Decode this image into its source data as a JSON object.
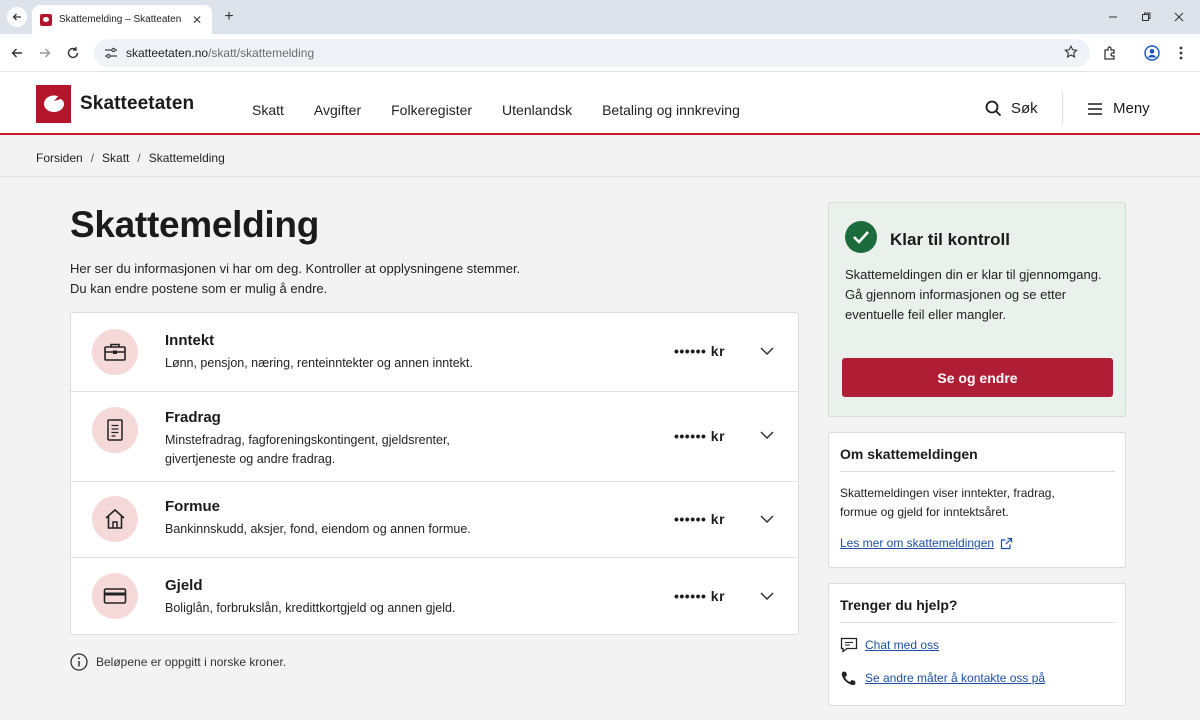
{
  "browser": {
    "tab_title": "Skattemelding – Skatteaten",
    "url_domain": "skatteetaten.no",
    "url_path": "/skatt/skattemelding"
  },
  "site": {
    "brand": "Skatteetaten",
    "nav": [
      "Skatt",
      "Avgifter",
      "Folkeregister",
      "Utenlandsk",
      "Betaling og innkreving"
    ],
    "search_label": "Søk",
    "menu_label": "Meny",
    "accent": "#c8192f"
  },
  "breadcrumb": [
    "Forsiden",
    "Skatt",
    "Skattemelding"
  ],
  "main": {
    "title": "Skattemelding",
    "intro_line1": "Her ser du informasjonen vi har om deg. Kontroller at opplysningene stemmer.",
    "intro_line2": "Du kan endre postene som er mulig å endre.",
    "items": [
      {
        "icon": "briefcase-icon",
        "title": "Inntekt",
        "desc": "Lønn, pensjon, næring, renteinntekter og annen inntekt.",
        "amount": "•••••• kr"
      },
      {
        "icon": "document-icon",
        "title": "Fradrag",
        "desc": "Minstefradrag, fagforeningskontingent, gjeldsrenter, givertjeneste og andre fradrag.",
        "amount": "•••••• kr"
      },
      {
        "icon": "house-icon",
        "title": "Formue",
        "desc": "Bankinnskudd, aksjer, fond, eiendom og annen formue.",
        "amount": "•••••• kr"
      },
      {
        "icon": "card-icon",
        "title": "Gjeld",
        "desc": "Boliglån, forbrukslån, kredittkortgjeld og annen gjeld.",
        "amount": "•••••• kr"
      }
    ],
    "footnote": "Beløpene er oppgitt i norske kroner."
  },
  "status": {
    "title": "Klar til kontroll",
    "text_line1": "Skattemeldingen din er klar til gjennomgang.",
    "text_line2": "Gå gjennom informasjonen og se etter eventuelle feil eller mangler.",
    "button": "Se og endre",
    "status_color": "#1c6b3c",
    "button_color": "#b01e36"
  },
  "about": {
    "title": "Om skattemeldingen",
    "text": "Skattemeldingen viser inntekter, fradrag, formue og gjeld for inntektsåret.",
    "link": "Les mer om skattemeldingen"
  },
  "help": {
    "title": "Trenger du hjelp?",
    "chat_link": "Chat med oss",
    "contact_link": "Se andre måter å kontakte oss på"
  }
}
